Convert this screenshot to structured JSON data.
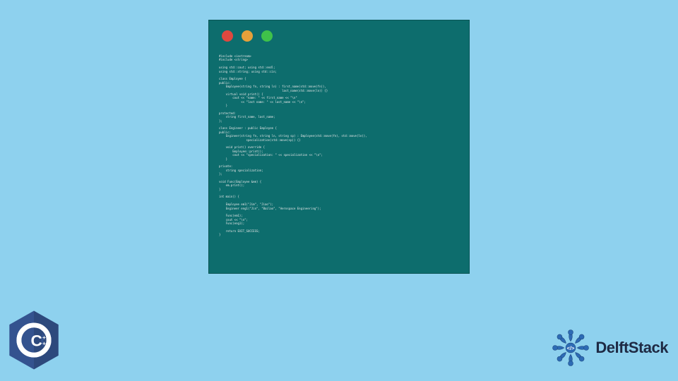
{
  "code": {
    "lines": [
      "#include <iostream>",
      "#include <string>",
      "",
      "using std::cout; using std::endl;",
      "using std::string; using std::cin;",
      "",
      "class Employee {",
      "public:",
      "    Employee(string fn, string ln) : first_name(std::move(fn)),",
      "                                     last_name(std::move(ln)) {}",
      "    virtual void print() {",
      "        cout << \"name: \" << first_name << \"\\n\"",
      "             << \"last name: \" << last_name << \"\\n\";",
      "    }",
      "",
      "protected:",
      "    string first_name, last_name;",
      "};",
      "",
      "class Engineer : public Employee {",
      "public:",
      "    Engineer(string fn, string ln, string sp) : Employee(std::move(fn), std::move(ln)),",
      "                specialization(std::move(sp)) {}",
      "",
      "    void print() override {",
      "        Employee::print();",
      "        cout << \"specialization: \" << specialization << \"\\n\";",
      "    }",
      "",
      "private:",
      "    string specialization;",
      "};",
      "",
      "void Func(Employee &em) {",
      "    em.print();",
      "}",
      "",
      "int main() {",
      "",
      "    Employee em1(\"Jim\", \"Jiao\");",
      "    Engineer eng1(\"Jin\", \"Bailao\", \"Aerospace Engineering\");",
      "",
      "    Func(em1);",
      "    cout << \"\\n\";",
      "    Func(eng1);",
      "",
      "    return EXIT_SUCCESS;",
      "}"
    ]
  },
  "logos": {
    "cpp_text": "C++",
    "delft_text": "DelftStack"
  },
  "colors": {
    "background": "#8ed1ee",
    "window": "#0d6d6d",
    "red": "#e0483f",
    "yellow": "#e6a03a",
    "green": "#3fc24a",
    "cpp_blue": "#34538f",
    "delft_blue": "#2d6bb5"
  }
}
